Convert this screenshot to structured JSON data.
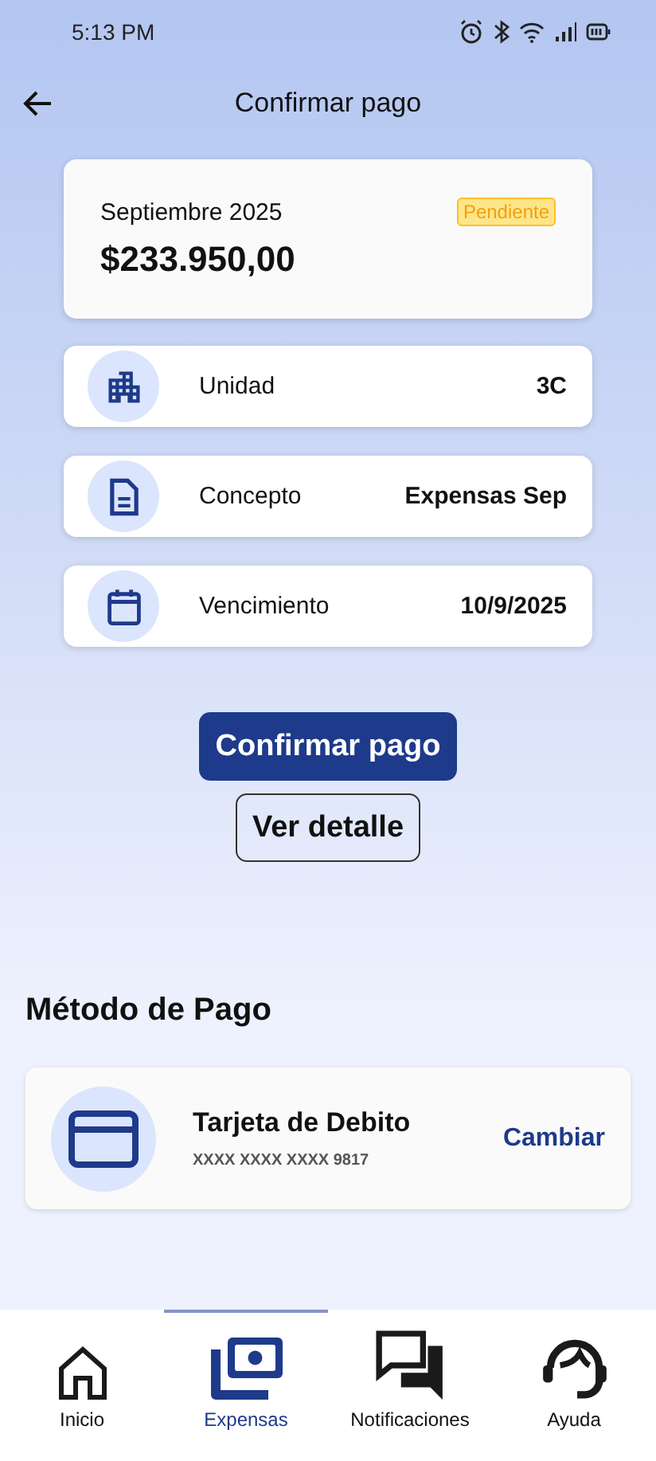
{
  "status_bar": {
    "time": "5:13 PM"
  },
  "header": {
    "title": "Confirmar pago"
  },
  "summary": {
    "period": "Septiembre 2025",
    "amount": "$233.950,00",
    "status": "Pendiente"
  },
  "details": [
    {
      "kind": "building",
      "label": "Unidad",
      "value": "3C"
    },
    {
      "kind": "document",
      "label": "Concepto",
      "value": "Expensas Sep"
    },
    {
      "kind": "calendar",
      "label": "Vencimiento",
      "value": "10/9/2025"
    }
  ],
  "actions": {
    "primary": "Confirmar pago",
    "secondary": "Ver detalle"
  },
  "payment_method": {
    "title": "Método de Pago",
    "name": "Tarjeta de Debito",
    "number": "XXXX XXXX XXXX 9817",
    "action": "Cambiar"
  },
  "nav": [
    {
      "kind": "home",
      "label": "Inicio",
      "selected": false
    },
    {
      "kind": "money",
      "label": "Expensas",
      "selected": true
    },
    {
      "kind": "chat",
      "label": "Notificaciones",
      "selected": false
    },
    {
      "kind": "support",
      "label": "Ayuda",
      "selected": false
    }
  ]
}
